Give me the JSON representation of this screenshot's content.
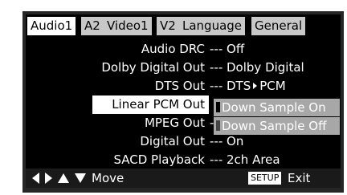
{
  "tabs": [
    {
      "label": "Audio1",
      "active": true
    },
    {
      "label": "A2",
      "active": false
    },
    {
      "label": "Video1",
      "active": false
    },
    {
      "label": "V2",
      "active": false
    },
    {
      "label": "Language",
      "active": false
    },
    {
      "label": "General",
      "active": false
    }
  ],
  "rows": [
    {
      "label": "Audio DRC",
      "value": "--- Off"
    },
    {
      "label": "Dolby Digital Out",
      "value": "--- Dolby Digital"
    },
    {
      "label": "DTS Out",
      "value_pre": "--- DTS",
      "value_post": "PCM"
    },
    {
      "label": "Linear PCM Out",
      "value": ""
    },
    {
      "label": "MPEG Out",
      "value": "-"
    },
    {
      "label": "Digital Out",
      "value": "--- On"
    },
    {
      "label": "SACD Playback",
      "value": "--- 2ch Area"
    }
  ],
  "popup": {
    "options": [
      {
        "label": "Down Sample On",
        "current": true
      },
      {
        "label": "Down Sample Off",
        "current": false
      }
    ]
  },
  "footer": {
    "move_label": "Move",
    "setup_label": "SETUP",
    "exit_label": "Exit"
  },
  "icons": {
    "nav": [
      "left-arrow-icon",
      "right-arrow-icon",
      "up-arrow-icon",
      "down-arrow-icon"
    ],
    "value_arrow": "arrow-right-icon"
  },
  "colors": {
    "background": "#000000",
    "tab": "#c8c8c8",
    "tab_active": "#ffffff",
    "popup": "#a7a7a7",
    "selected_row": "#ffffff"
  }
}
